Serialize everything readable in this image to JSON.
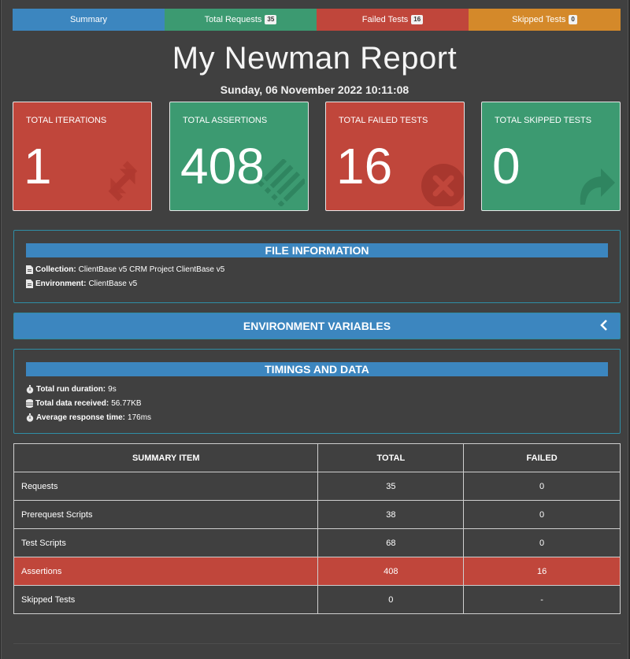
{
  "nav": {
    "tabs": [
      {
        "label": "Summary",
        "badge": "",
        "color": "#3c86bf"
      },
      {
        "label": "Total Requests",
        "badge": "35",
        "color": "#3c9a71"
      },
      {
        "label": "Failed Tests",
        "badge": "16",
        "color": "#c0463b"
      },
      {
        "label": "Skipped Tests",
        "badge": "0",
        "color": "#d4892a"
      }
    ]
  },
  "report": {
    "title": "My Newman Report",
    "timestamp": "Sunday, 06 November 2022 10:11:08"
  },
  "cards": [
    {
      "label": "TOTAL ITERATIONS",
      "value": "1",
      "color": "#c0463b",
      "icon": "refresh-icon"
    },
    {
      "label": "TOTAL ASSERTIONS",
      "value": "408",
      "color": "#3c9a71",
      "icon": "list-icon"
    },
    {
      "label": "TOTAL FAILED TESTS",
      "value": "16",
      "color": "#c0463b",
      "icon": "times-circle-icon"
    },
    {
      "label": "TOTAL SKIPPED TESTS",
      "value": "0",
      "color": "#3c9a71",
      "icon": "share-icon"
    }
  ],
  "file_info": {
    "heading": "FILE INFORMATION",
    "collection_label": "Collection:",
    "collection_value": "ClientBase v5 CRM Project ClientBase v5",
    "environment_label": "Environment:",
    "environment_value": "ClientBase v5"
  },
  "env_vars": {
    "heading": "ENVIRONMENT VARIABLES"
  },
  "timings": {
    "heading": "TIMINGS AND DATA",
    "run_duration_label": "Total run duration:",
    "run_duration_value": "9s",
    "data_received_label": "Total data received:",
    "data_received_value": "56.77KB",
    "avg_response_label": "Average response time:",
    "avg_response_value": "176ms"
  },
  "summary_table": {
    "headers": [
      "SUMMARY ITEM",
      "TOTAL",
      "FAILED"
    ],
    "rows": [
      {
        "item": "Requests",
        "total": "35",
        "failed": "0",
        "highlight": false
      },
      {
        "item": "Prerequest Scripts",
        "total": "38",
        "failed": "0",
        "highlight": false
      },
      {
        "item": "Test Scripts",
        "total": "68",
        "failed": "0",
        "highlight": false
      },
      {
        "item": "Assertions",
        "total": "408",
        "failed": "16",
        "highlight": true
      },
      {
        "item": "Skipped Tests",
        "total": "0",
        "failed": "-",
        "highlight": false
      }
    ]
  }
}
